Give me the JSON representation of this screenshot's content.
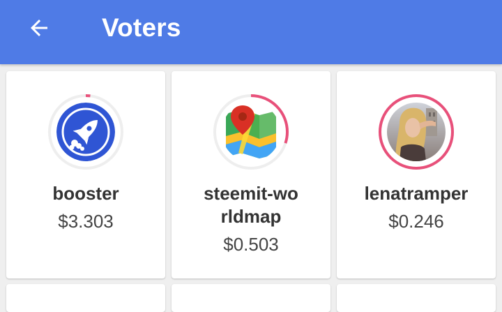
{
  "header": {
    "title": "Voters",
    "back_icon": "arrow-left-icon",
    "background_color": "#4f7be6"
  },
  "accent_color": "#e8507a",
  "voters": [
    {
      "name": "booster",
      "payout": "$3.303",
      "avatar_icon": "rocket-icon",
      "vote_weight": 0.02
    },
    {
      "name": "steemit-worldmap",
      "payout": "$0.503",
      "avatar_icon": "map-pin-icon",
      "vote_weight": 0.3
    },
    {
      "name": "lenatramper",
      "payout": "$0.246",
      "avatar_icon": "user-photo",
      "vote_weight": 1.0
    }
  ]
}
